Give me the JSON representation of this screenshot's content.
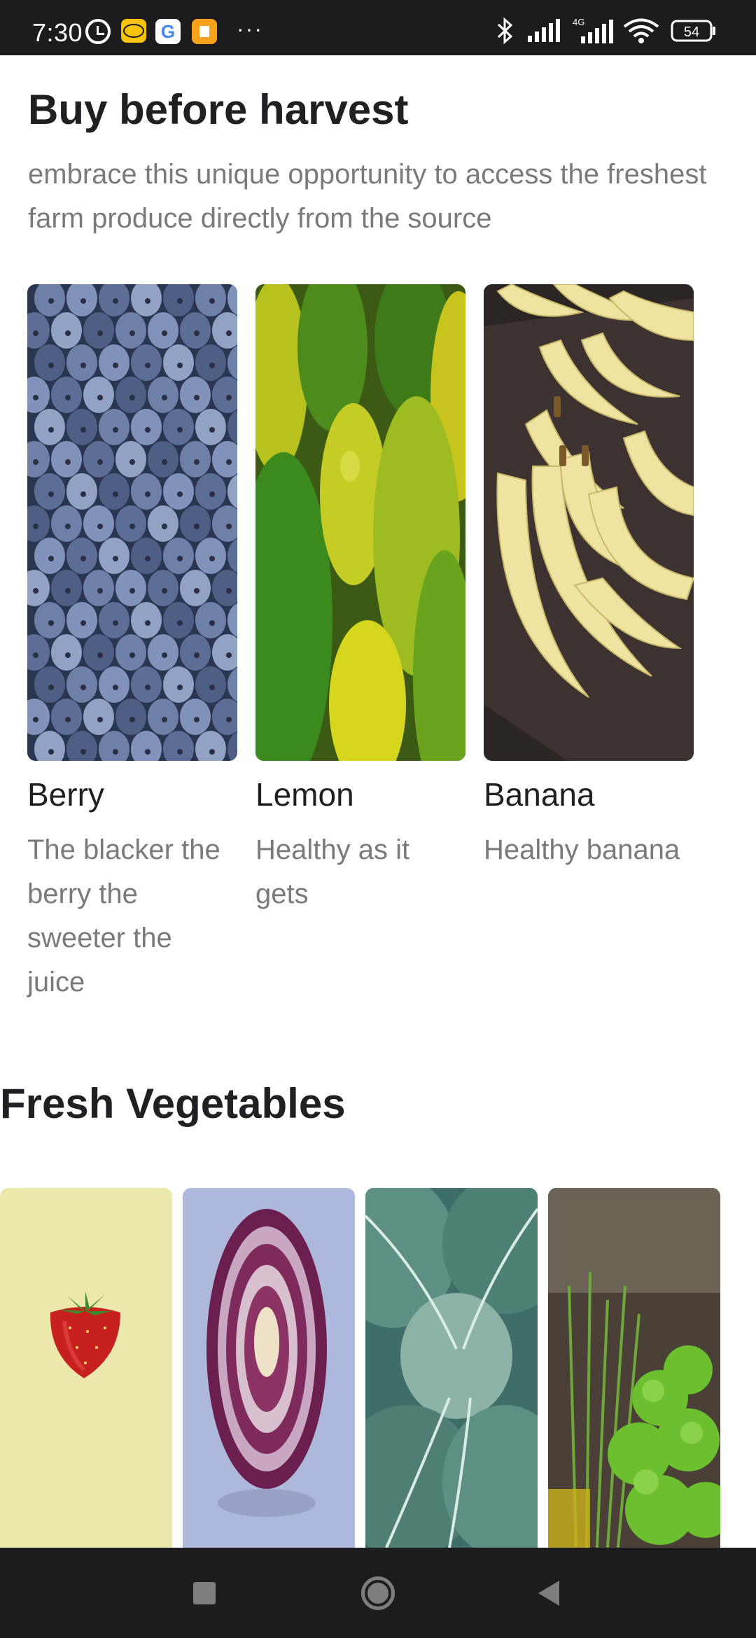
{
  "status_bar": {
    "time": "7:30",
    "network_type": "4G",
    "battery": "54",
    "more": "···",
    "google_letter": "G",
    "icons": [
      "alarm-icon",
      "mtn-app-icon",
      "google-icon",
      "shopping-bag-icon",
      "more-icon",
      "bluetooth-icon",
      "signal-icon",
      "signal-4g-icon",
      "wifi-icon",
      "battery-icon"
    ]
  },
  "harvest": {
    "title": "Buy before harvest",
    "subtitle": "embrace this unique opportunity to access the freshest farm produce directly from the source",
    "items": [
      {
        "name": "Berry",
        "description": "The blacker the berry the sweeter the juice",
        "image": "blueberries-photo"
      },
      {
        "name": "Lemon",
        "description": "Healthy as it gets",
        "image": "lemons-photo"
      },
      {
        "name": "Banana",
        "description": "Healthy banana",
        "image": "bananas-photo"
      }
    ]
  },
  "vegetables": {
    "title": "Fresh Vegetables",
    "items": [
      {
        "image": "strawberry-photo"
      },
      {
        "image": "red-cabbage-photo"
      },
      {
        "image": "cabbage-leaves-photo"
      },
      {
        "image": "herbs-photo"
      }
    ]
  },
  "nav_bar": {
    "buttons": [
      "recents-button",
      "home-button",
      "back-button"
    ]
  },
  "colors": {
    "status_bar_bg": "#1c1c1e",
    "title": "#1e2023",
    "subtitle": "#7a7a7a",
    "nav_icon": "#7d7d7d"
  }
}
